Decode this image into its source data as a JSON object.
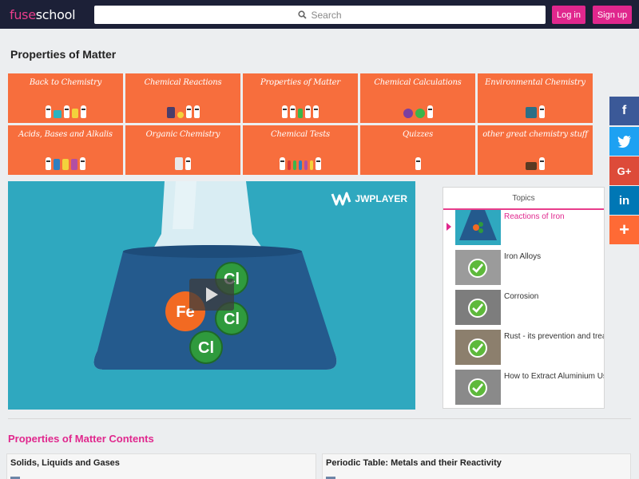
{
  "header": {
    "logo_part1": "fuse",
    "logo_part2": "school",
    "search_placeholder": "Search",
    "login_label": "Log in",
    "signup_label": "Sign up"
  },
  "page_title": "Properties of Matter",
  "tiles": [
    {
      "label": "Back to Chemistry"
    },
    {
      "label": "Chemical Reactions"
    },
    {
      "label": "Properties of Matter"
    },
    {
      "label": "Chemical Calculations"
    },
    {
      "label": "Environmental Chemistry"
    },
    {
      "label": "Acids, Bases and Alkalis"
    },
    {
      "label": "Organic Chemistry"
    },
    {
      "label": "Chemical Tests"
    },
    {
      "label": "Quizzes"
    },
    {
      "label": "other great chemistry stuff"
    }
  ],
  "video": {
    "player_brand": "JWPLAYER",
    "fe_label": "Fe",
    "cl_label": "Cl"
  },
  "topics": {
    "header": "Topics",
    "items": [
      {
        "title": "Reactions of Iron",
        "active": true,
        "watched": false
      },
      {
        "title": "Iron Alloys",
        "active": false,
        "watched": true
      },
      {
        "title": "Corrosion",
        "active": false,
        "watched": true
      },
      {
        "title": "Rust - its prevention and trea",
        "active": false,
        "watched": true
      },
      {
        "title": "How to Extract Aluminium Us",
        "active": false,
        "watched": true
      }
    ]
  },
  "share": {
    "facebook": "f",
    "twitter": "twitter-icon",
    "googleplus": "G+",
    "linkedin": "in",
    "more": "+"
  },
  "contents": {
    "title": "Properties of Matter Contents",
    "cards": [
      {
        "title": "Solids, Liquids and Gases"
      },
      {
        "title": "Periodic Table: Metals and their Reactivity"
      }
    ]
  },
  "colors": {
    "header_bg": "#1c2037",
    "brand_pink": "#e0278d",
    "tile_orange": "#f76e3d",
    "video_bg": "#2fa8bf",
    "check_green": "#5eb93b"
  }
}
